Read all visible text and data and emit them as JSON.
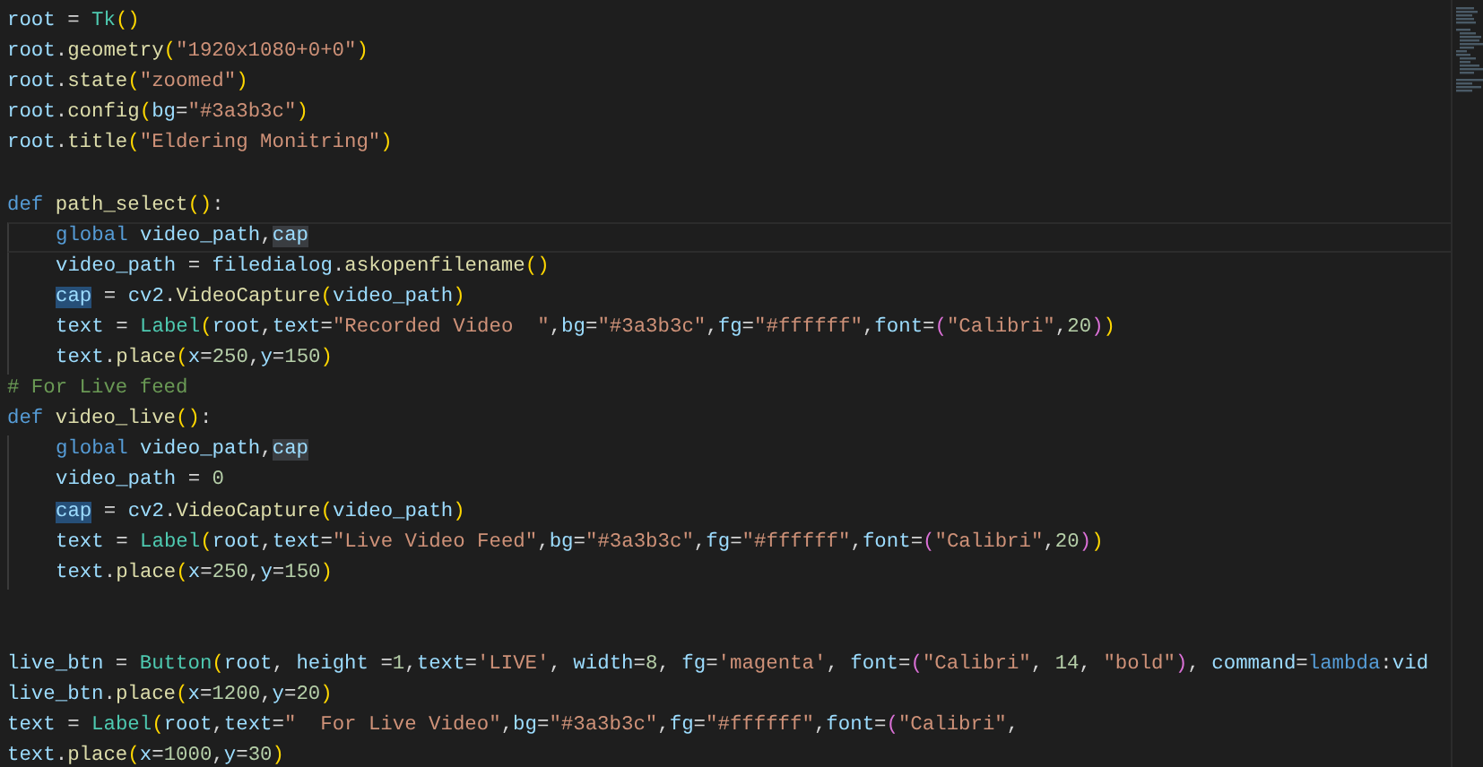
{
  "editor": {
    "lines": [
      {
        "current": false,
        "indented": false,
        "tokens": [
          {
            "t": "root",
            "kind": "var"
          },
          {
            "t": " = ",
            "kind": "op"
          },
          {
            "t": "Tk",
            "kind": "cls"
          },
          {
            "t": "()",
            "kind": "br1"
          }
        ]
      },
      {
        "current": false,
        "indented": false,
        "tokens": [
          {
            "t": "root",
            "kind": "var"
          },
          {
            "t": ".",
            "kind": "op"
          },
          {
            "t": "geometry",
            "kind": "fn"
          },
          {
            "t": "(",
            "kind": "br1"
          },
          {
            "t": "\"1920x1080+0+0\"",
            "kind": "str"
          },
          {
            "t": ")",
            "kind": "br1"
          }
        ]
      },
      {
        "current": false,
        "indented": false,
        "tokens": [
          {
            "t": "root",
            "kind": "var"
          },
          {
            "t": ".",
            "kind": "op"
          },
          {
            "t": "state",
            "kind": "fn"
          },
          {
            "t": "(",
            "kind": "br1"
          },
          {
            "t": "\"zoomed\"",
            "kind": "str"
          },
          {
            "t": ")",
            "kind": "br1"
          }
        ]
      },
      {
        "current": false,
        "indented": false,
        "tokens": [
          {
            "t": "root",
            "kind": "var"
          },
          {
            "t": ".",
            "kind": "op"
          },
          {
            "t": "config",
            "kind": "fn"
          },
          {
            "t": "(",
            "kind": "br1"
          },
          {
            "t": "bg",
            "kind": "var"
          },
          {
            "t": "=",
            "kind": "op"
          },
          {
            "t": "\"#3a3b3c\"",
            "kind": "str"
          },
          {
            "t": ")",
            "kind": "br1"
          }
        ]
      },
      {
        "current": false,
        "indented": false,
        "tokens": [
          {
            "t": "root",
            "kind": "var"
          },
          {
            "t": ".",
            "kind": "op"
          },
          {
            "t": "title",
            "kind": "fn"
          },
          {
            "t": "(",
            "kind": "br1"
          },
          {
            "t": "\"Eldering Monitring\"",
            "kind": "str"
          },
          {
            "t": ")",
            "kind": "br1"
          }
        ]
      },
      {
        "current": false,
        "indented": false
      },
      {
        "current": false,
        "indented": false,
        "tokens": [
          {
            "t": "def ",
            "kind": "kw"
          },
          {
            "t": "path_select",
            "kind": "fn"
          },
          {
            "t": "()",
            "kind": "br1"
          },
          {
            "t": ":",
            "kind": "op"
          }
        ]
      },
      {
        "current": true,
        "indented": true,
        "tokens": [
          {
            "t": "global ",
            "kind": "kw"
          },
          {
            "t": "video_path",
            "kind": "var"
          },
          {
            "t": ",",
            "kind": "op"
          },
          {
            "t": "cap",
            "kind": "match"
          }
        ]
      },
      {
        "current": false,
        "indented": true,
        "tokens": [
          {
            "t": "video_path",
            "kind": "var"
          },
          {
            "t": " = ",
            "kind": "op"
          },
          {
            "t": "filedialog",
            "kind": "var"
          },
          {
            "t": ".",
            "kind": "op"
          },
          {
            "t": "askopenfilename",
            "kind": "fn"
          },
          {
            "t": "()",
            "kind": "br1"
          }
        ]
      },
      {
        "current": false,
        "indented": true,
        "tokens": [
          {
            "t": "cap",
            "kind": "focus"
          },
          {
            "t": " = ",
            "kind": "op"
          },
          {
            "t": "cv2",
            "kind": "var"
          },
          {
            "t": ".",
            "kind": "op"
          },
          {
            "t": "VideoCapture",
            "kind": "fn"
          },
          {
            "t": "(",
            "kind": "br1"
          },
          {
            "t": "video_path",
            "kind": "var"
          },
          {
            "t": ")",
            "kind": "br1"
          }
        ]
      },
      {
        "current": false,
        "indented": true,
        "tokens": [
          {
            "t": "text",
            "kind": "var"
          },
          {
            "t": " = ",
            "kind": "op"
          },
          {
            "t": "Label",
            "kind": "cls"
          },
          {
            "t": "(",
            "kind": "br1"
          },
          {
            "t": "root",
            "kind": "var"
          },
          {
            "t": ",",
            "kind": "op"
          },
          {
            "t": "text",
            "kind": "var"
          },
          {
            "t": "=",
            "kind": "op"
          },
          {
            "t": "\"Recorded Video  \"",
            "kind": "str"
          },
          {
            "t": ",",
            "kind": "op"
          },
          {
            "t": "bg",
            "kind": "var"
          },
          {
            "t": "=",
            "kind": "op"
          },
          {
            "t": "\"#3a3b3c\"",
            "kind": "str"
          },
          {
            "t": ",",
            "kind": "op"
          },
          {
            "t": "fg",
            "kind": "var"
          },
          {
            "t": "=",
            "kind": "op"
          },
          {
            "t": "\"#ffffff\"",
            "kind": "str"
          },
          {
            "t": ",",
            "kind": "op"
          },
          {
            "t": "font",
            "kind": "var"
          },
          {
            "t": "=",
            "kind": "op"
          },
          {
            "t": "(",
            "kind": "br2"
          },
          {
            "t": "\"Calibri\"",
            "kind": "str"
          },
          {
            "t": ",",
            "kind": "op"
          },
          {
            "t": "20",
            "kind": "num"
          },
          {
            "t": ")",
            "kind": "br2"
          },
          {
            "t": ")",
            "kind": "br1"
          }
        ]
      },
      {
        "current": false,
        "indented": true,
        "tokens": [
          {
            "t": "text",
            "kind": "var"
          },
          {
            "t": ".",
            "kind": "op"
          },
          {
            "t": "place",
            "kind": "fn"
          },
          {
            "t": "(",
            "kind": "br1"
          },
          {
            "t": "x",
            "kind": "var"
          },
          {
            "t": "=",
            "kind": "op"
          },
          {
            "t": "250",
            "kind": "num"
          },
          {
            "t": ",",
            "kind": "op"
          },
          {
            "t": "y",
            "kind": "var"
          },
          {
            "t": "=",
            "kind": "op"
          },
          {
            "t": "150",
            "kind": "num"
          },
          {
            "t": ")",
            "kind": "br1"
          }
        ]
      },
      {
        "current": false,
        "indented": false,
        "tokens": [
          {
            "t": "# For Live feed",
            "kind": "com"
          }
        ]
      },
      {
        "current": false,
        "indented": false,
        "tokens": [
          {
            "t": "def ",
            "kind": "kw"
          },
          {
            "t": "video_live",
            "kind": "fn"
          },
          {
            "t": "()",
            "kind": "br1"
          },
          {
            "t": ":",
            "kind": "op"
          }
        ]
      },
      {
        "current": false,
        "indented": true,
        "tokens": [
          {
            "t": "global ",
            "kind": "kw"
          },
          {
            "t": "video_path",
            "kind": "var"
          },
          {
            "t": ",",
            "kind": "op"
          },
          {
            "t": "cap",
            "kind": "match"
          }
        ]
      },
      {
        "current": false,
        "indented": true,
        "tokens": [
          {
            "t": "video_path",
            "kind": "var"
          },
          {
            "t": " = ",
            "kind": "op"
          },
          {
            "t": "0",
            "kind": "num"
          }
        ]
      },
      {
        "current": false,
        "indented": true,
        "tokens": [
          {
            "t": "cap",
            "kind": "focus"
          },
          {
            "t": " = ",
            "kind": "op"
          },
          {
            "t": "cv2",
            "kind": "var"
          },
          {
            "t": ".",
            "kind": "op"
          },
          {
            "t": "VideoCapture",
            "kind": "fn"
          },
          {
            "t": "(",
            "kind": "br1"
          },
          {
            "t": "video_path",
            "kind": "var"
          },
          {
            "t": ")",
            "kind": "br1"
          }
        ]
      },
      {
        "current": false,
        "indented": true,
        "tokens": [
          {
            "t": "text",
            "kind": "var"
          },
          {
            "t": " = ",
            "kind": "op"
          },
          {
            "t": "Label",
            "kind": "cls"
          },
          {
            "t": "(",
            "kind": "br1"
          },
          {
            "t": "root",
            "kind": "var"
          },
          {
            "t": ",",
            "kind": "op"
          },
          {
            "t": "text",
            "kind": "var"
          },
          {
            "t": "=",
            "kind": "op"
          },
          {
            "t": "\"Live Video Feed\"",
            "kind": "str"
          },
          {
            "t": ",",
            "kind": "op"
          },
          {
            "t": "bg",
            "kind": "var"
          },
          {
            "t": "=",
            "kind": "op"
          },
          {
            "t": "\"#3a3b3c\"",
            "kind": "str"
          },
          {
            "t": ",",
            "kind": "op"
          },
          {
            "t": "fg",
            "kind": "var"
          },
          {
            "t": "=",
            "kind": "op"
          },
          {
            "t": "\"#ffffff\"",
            "kind": "str"
          },
          {
            "t": ",",
            "kind": "op"
          },
          {
            "t": "font",
            "kind": "var"
          },
          {
            "t": "=",
            "kind": "op"
          },
          {
            "t": "(",
            "kind": "br2"
          },
          {
            "t": "\"Calibri\"",
            "kind": "str"
          },
          {
            "t": ",",
            "kind": "op"
          },
          {
            "t": "20",
            "kind": "num"
          },
          {
            "t": ")",
            "kind": "br2"
          },
          {
            "t": ")",
            "kind": "br1"
          }
        ]
      },
      {
        "current": false,
        "indented": true,
        "tokens": [
          {
            "t": "text",
            "kind": "var"
          },
          {
            "t": ".",
            "kind": "op"
          },
          {
            "t": "place",
            "kind": "fn"
          },
          {
            "t": "(",
            "kind": "br1"
          },
          {
            "t": "x",
            "kind": "var"
          },
          {
            "t": "=",
            "kind": "op"
          },
          {
            "t": "250",
            "kind": "num"
          },
          {
            "t": ",",
            "kind": "op"
          },
          {
            "t": "y",
            "kind": "var"
          },
          {
            "t": "=",
            "kind": "op"
          },
          {
            "t": "150",
            "kind": "num"
          },
          {
            "t": ")",
            "kind": "br1"
          }
        ]
      },
      {
        "current": false,
        "indented": false
      },
      {
        "current": false,
        "indented": false
      },
      {
        "current": false,
        "indented": false,
        "tokens": [
          {
            "t": "live_btn",
            "kind": "var"
          },
          {
            "t": " = ",
            "kind": "op"
          },
          {
            "t": "Button",
            "kind": "cls"
          },
          {
            "t": "(",
            "kind": "br1"
          },
          {
            "t": "root",
            "kind": "var"
          },
          {
            "t": ", ",
            "kind": "op"
          },
          {
            "t": "height",
            "kind": "var"
          },
          {
            "t": " =",
            "kind": "op"
          },
          {
            "t": "1",
            "kind": "num"
          },
          {
            "t": ",",
            "kind": "op"
          },
          {
            "t": "text",
            "kind": "var"
          },
          {
            "t": "=",
            "kind": "op"
          },
          {
            "t": "'LIVE'",
            "kind": "str"
          },
          {
            "t": ", ",
            "kind": "op"
          },
          {
            "t": "width",
            "kind": "var"
          },
          {
            "t": "=",
            "kind": "op"
          },
          {
            "t": "8",
            "kind": "num"
          },
          {
            "t": ", ",
            "kind": "op"
          },
          {
            "t": "fg",
            "kind": "var"
          },
          {
            "t": "=",
            "kind": "op"
          },
          {
            "t": "'magenta'",
            "kind": "str"
          },
          {
            "t": ", ",
            "kind": "op"
          },
          {
            "t": "font",
            "kind": "var"
          },
          {
            "t": "=",
            "kind": "op"
          },
          {
            "t": "(",
            "kind": "br2"
          },
          {
            "t": "\"Calibri\"",
            "kind": "str"
          },
          {
            "t": ", ",
            "kind": "op"
          },
          {
            "t": "14",
            "kind": "num"
          },
          {
            "t": ", ",
            "kind": "op"
          },
          {
            "t": "\"bold\"",
            "kind": "str"
          },
          {
            "t": ")",
            "kind": "br2"
          },
          {
            "t": ", ",
            "kind": "op"
          },
          {
            "t": "command",
            "kind": "var"
          },
          {
            "t": "=",
            "kind": "op"
          },
          {
            "t": "lambda",
            "kind": "kw"
          },
          {
            "t": ":",
            "kind": "op"
          },
          {
            "t": "vid",
            "kind": "var"
          }
        ]
      },
      {
        "current": false,
        "indented": false,
        "tokens": [
          {
            "t": "live_btn",
            "kind": "var"
          },
          {
            "t": ".",
            "kind": "op"
          },
          {
            "t": "place",
            "kind": "fn"
          },
          {
            "t": "(",
            "kind": "br1"
          },
          {
            "t": "x",
            "kind": "var"
          },
          {
            "t": "=",
            "kind": "op"
          },
          {
            "t": "1200",
            "kind": "num"
          },
          {
            "t": ",",
            "kind": "op"
          },
          {
            "t": "y",
            "kind": "var"
          },
          {
            "t": "=",
            "kind": "op"
          },
          {
            "t": "20",
            "kind": "num"
          },
          {
            "t": ")",
            "kind": "br1"
          }
        ]
      },
      {
        "current": false,
        "indented": false,
        "tokens": [
          {
            "t": "text",
            "kind": "var"
          },
          {
            "t": " = ",
            "kind": "op"
          },
          {
            "t": "Label",
            "kind": "cls"
          },
          {
            "t": "(",
            "kind": "br1"
          },
          {
            "t": "root",
            "kind": "var"
          },
          {
            "t": ",",
            "kind": "op"
          },
          {
            "t": "text",
            "kind": "var"
          },
          {
            "t": "=",
            "kind": "op"
          },
          {
            "t": "\"  For Live Video\"",
            "kind": "str"
          },
          {
            "t": ",",
            "kind": "op"
          },
          {
            "t": "bg",
            "kind": "var"
          },
          {
            "t": "=",
            "kind": "op"
          },
          {
            "t": "\"#3a3b3c\"",
            "kind": "str"
          },
          {
            "t": ",",
            "kind": "op"
          },
          {
            "t": "fg",
            "kind": "var"
          },
          {
            "t": "=",
            "kind": "op"
          },
          {
            "t": "\"#ffffff\"",
            "kind": "str"
          },
          {
            "t": ",",
            "kind": "op"
          },
          {
            "t": "font",
            "kind": "var"
          },
          {
            "t": "=",
            "kind": "op"
          },
          {
            "t": "(",
            "kind": "br2"
          },
          {
            "t": "\"Calibri\"",
            "kind": "str"
          },
          {
            "t": ",",
            "kind": "op"
          }
        ]
      },
      {
        "current": false,
        "indented": false,
        "tokens": [
          {
            "t": "text",
            "kind": "var"
          },
          {
            "t": ".",
            "kind": "op"
          },
          {
            "t": "place",
            "kind": "fn"
          },
          {
            "t": "(",
            "kind": "br1"
          },
          {
            "t": "x",
            "kind": "var"
          },
          {
            "t": "=",
            "kind": "op"
          },
          {
            "t": "1000",
            "kind": "num"
          },
          {
            "t": ",",
            "kind": "op"
          },
          {
            "t": "y",
            "kind": "var"
          },
          {
            "t": "=",
            "kind": "op"
          },
          {
            "t": "30",
            "kind": "num"
          },
          {
            "t": ")",
            "kind": "br1"
          }
        ]
      }
    ]
  }
}
